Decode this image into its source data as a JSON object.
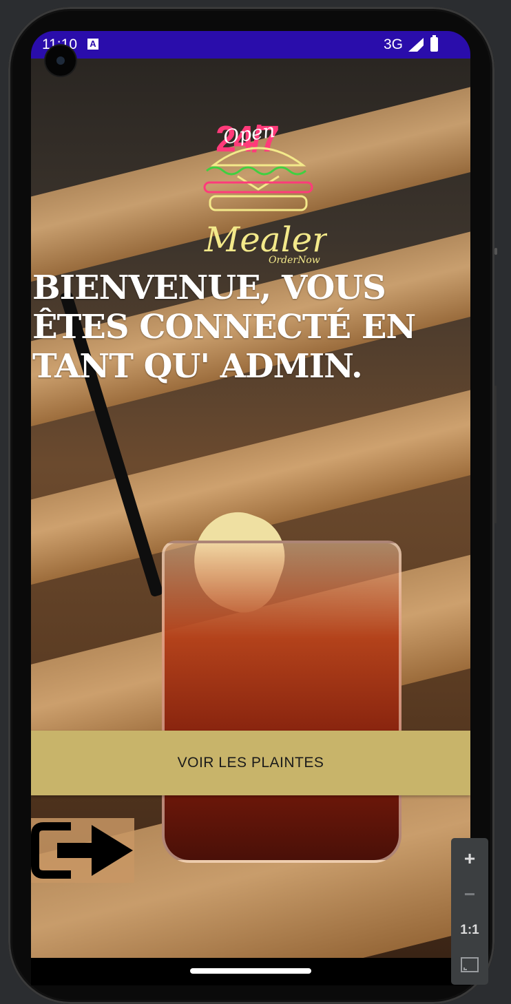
{
  "status_bar": {
    "time": "11:10",
    "notification_icon": "A",
    "network": "3G",
    "signal_icon": "signal-icon",
    "battery_icon": "battery-icon"
  },
  "logo": {
    "open_label": "Open",
    "hours_label": "24/7",
    "brand_name": "Mealer",
    "tagline": "OrderNow"
  },
  "main": {
    "headline": "BIENVENUE, VOUS ÊTES CONNECTÉ EN TANT QU' ADMIN.",
    "complaints_button_label": "VOIR LES PLAINTES",
    "logout_icon": "logout-icon"
  },
  "zoom_panel": {
    "zoom_in": "+",
    "zoom_out": "−",
    "actual_size": "1:1",
    "fit_icon": "fit-screen-icon"
  },
  "colors": {
    "status_bar": "#2a0dab",
    "button": "#c8b46a",
    "logo_pink": "#ff3b7a",
    "logo_yellow": "#f3e98a",
    "logo_green": "#40d040"
  }
}
